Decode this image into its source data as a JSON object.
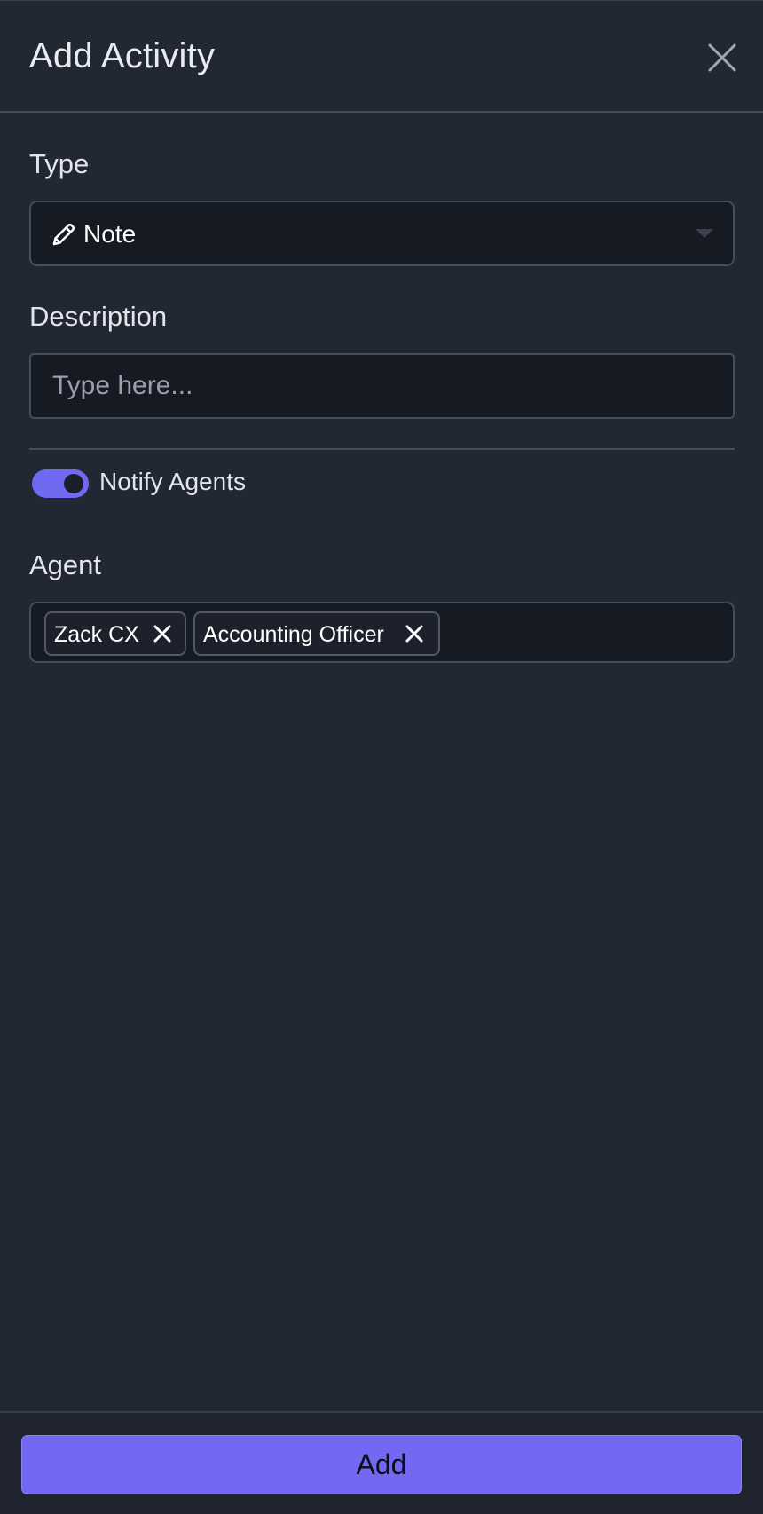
{
  "modal": {
    "title": "Add Activity"
  },
  "type_field": {
    "label": "Type",
    "value": "Note",
    "icon": "pencil-icon"
  },
  "description_field": {
    "label": "Description",
    "value": "",
    "placeholder": "Type here..."
  },
  "notify": {
    "label": "Notify Agents",
    "enabled": true
  },
  "agent_field": {
    "label": "Agent",
    "tags": [
      {
        "label": "Zack CX"
      },
      {
        "label": "Accounting Officer"
      }
    ]
  },
  "footer": {
    "add_label": "Add"
  },
  "colors": {
    "accent": "#7268f1",
    "background": "#222734",
    "input_background": "#161a23"
  }
}
